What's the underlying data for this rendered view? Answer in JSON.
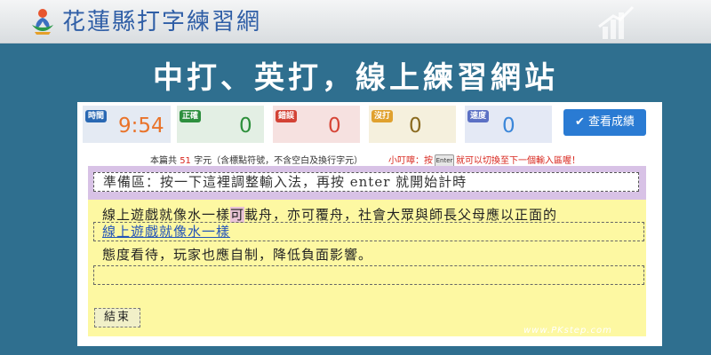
{
  "header": {
    "site_title": "花蓮縣打字練習網"
  },
  "banner": {
    "title": "中打、英打，線上練習網站"
  },
  "stats": {
    "time": {
      "label": "時間",
      "value": "9:54"
    },
    "correct": {
      "label": "正確",
      "value": "0"
    },
    "wrong": {
      "label": "錯誤",
      "value": "0"
    },
    "missed": {
      "label": "沒打",
      "value": "0"
    },
    "speed": {
      "label": "速度",
      "value": "0"
    }
  },
  "result_button": {
    "label": "查看成績"
  },
  "info": {
    "prefix": "本篇共",
    "count": "51",
    "suffix": "字元（含標點符號，不含空白及換行字元）"
  },
  "tip": {
    "prefix": "小叮嚀：按",
    "key_label": "Enter",
    "suffix": "就可以切換至下一個輸入區喔！"
  },
  "prep": {
    "text": "準備區：按一下這裡調整輸入法，再按 enter 就開始計時"
  },
  "passage": {
    "line1_before": "線上遊戲就像水一樣",
    "line1_highlight": "可",
    "line1_after": "載舟，亦可覆舟，社會大眾與師長父母應以正面的",
    "input1_typed": "線上遊戲就像水一樣",
    "line3": "態度看待，玩家也應自制，降低負面影響。",
    "input2_typed": ""
  },
  "end_button": {
    "label": "結束"
  },
  "watermark": "www.PKstep.com",
  "colors": {
    "background": "#2f6f8f",
    "accent": "#2a7bd3",
    "prep_area": "#d8c2e6",
    "type_area": "#fdf8a2"
  },
  "icons": {
    "logo": "lotus-logo-icon",
    "check": "check-icon",
    "key": "enter-key-icon"
  }
}
